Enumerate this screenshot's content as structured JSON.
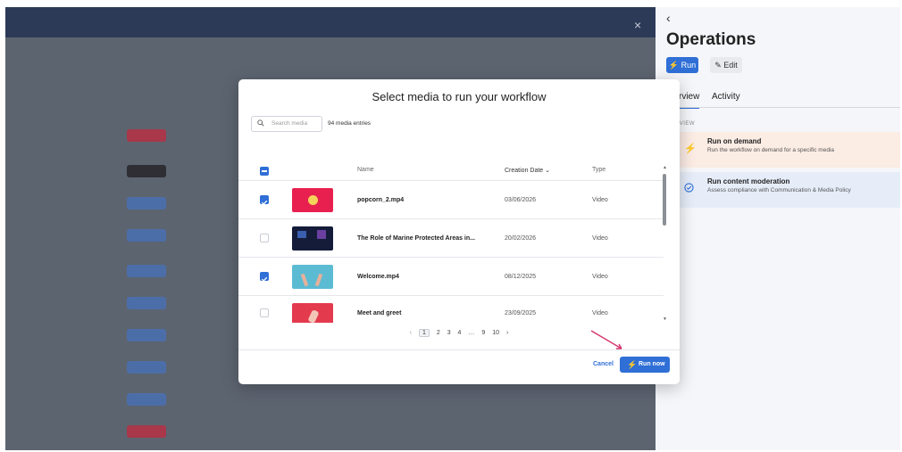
{
  "background": {
    "close_glyph": "×"
  },
  "panel": {
    "back_glyph": "‹",
    "title": "Operations",
    "run_label": "Run",
    "edit_label": "Edit",
    "tabs": [
      {
        "label": "rview",
        "active": true
      },
      {
        "label": "Activity",
        "active": false
      }
    ],
    "section_label": "RVIEW",
    "cards": [
      {
        "title": "Run on demand",
        "description": "Run the workflow on demand for a specific media",
        "icon": "bolt-icon"
      },
      {
        "title": "Run content moderation",
        "description": "Assess compliance with Communication & Media Policy",
        "icon": "check-circle-icon"
      }
    ]
  },
  "modal": {
    "title": "Select media to run your workflow",
    "search_placeholder": "Search media",
    "entries_count": "94 media entries",
    "columns": {
      "name": "Name",
      "creation_date": "Creation Date",
      "type": "Type"
    },
    "rows": [
      {
        "name": "popcorn_2.mp4",
        "date": "03/06/2026",
        "type": "Video",
        "checked": true,
        "thumb": "#e8204f"
      },
      {
        "name": "The Role of Marine Protected Areas in...",
        "date": "20/02/2026",
        "type": "Video",
        "checked": false,
        "thumb": "#141c3a"
      },
      {
        "name": "Welcome.mp4",
        "date": "08/12/2025",
        "type": "Video",
        "checked": true,
        "thumb": "#5bbbd3"
      },
      {
        "name": "Meet and greet",
        "date": "23/09/2025",
        "type": "Video",
        "checked": false,
        "thumb": "#e33a4e"
      }
    ],
    "pagination": {
      "prev": "‹",
      "pages": [
        "1",
        "2",
        "3",
        "4",
        "…",
        "9",
        "10"
      ],
      "current": "1",
      "next": "›"
    },
    "cancel_label": "Cancel",
    "run_now_label": "Run now"
  },
  "colors": {
    "accent": "#2f6fd6",
    "arrow": "#d6336c"
  }
}
